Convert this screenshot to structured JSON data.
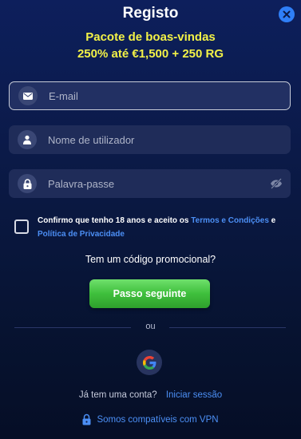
{
  "header": {
    "title": "Registo",
    "promo_line1": "Pacote de boas-vindas",
    "promo_line2": "250% até €1,500 + 250 RG"
  },
  "form": {
    "email_placeholder": "E-mail",
    "username_placeholder": "Nome de utilizador",
    "password_placeholder": "Palavra-passe"
  },
  "consent": {
    "text_before": "Confirmo que tenho 18 anos e aceito os ",
    "terms_link": "Termos e Condições",
    "and_text": " e ",
    "privacy_link": "Política de Privacidade"
  },
  "promo_code_question": "Tem um código promocional?",
  "next_button": "Passo seguinte",
  "or_text": "ou",
  "login": {
    "question": "Já tem uma conta?",
    "link": "Iniciar sessão"
  },
  "vpn_text": "Somos compatíveis com VPN",
  "colors": {
    "accent_blue": "#2f7ff7",
    "promo_yellow": "#f3f247",
    "button_green": "#3fbf3c",
    "link_blue": "#4c8ff5"
  }
}
